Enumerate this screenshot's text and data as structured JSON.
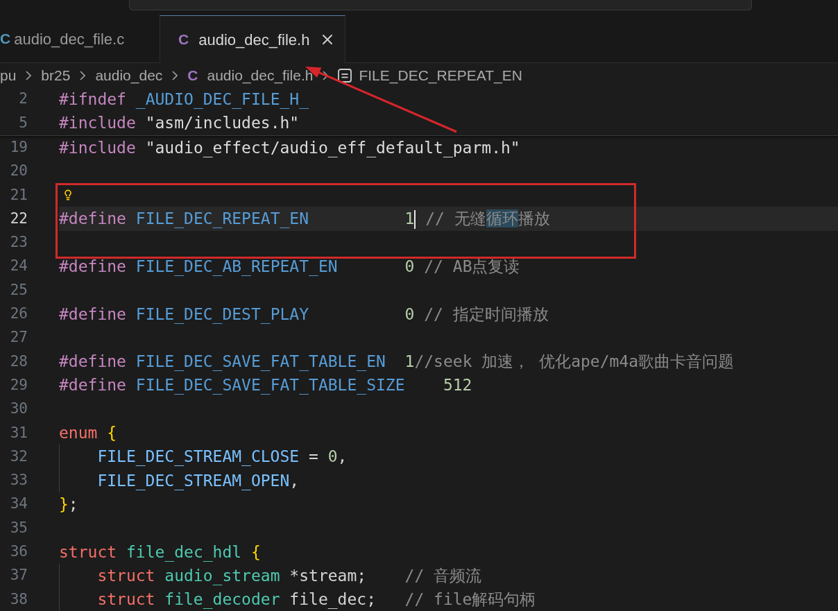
{
  "tabs": [
    {
      "icon": "C",
      "color": "#519aba",
      "label": "audio_dec_file.c",
      "selected": false
    },
    {
      "icon": "C",
      "color": "#a074c4",
      "label": "audio_dec_file.h",
      "selected": true
    }
  ],
  "breadcrumb": [
    {
      "kind": "folder",
      "label": "pu"
    },
    {
      "kind": "folder",
      "label": "br25"
    },
    {
      "kind": "folder",
      "label": "audio_dec"
    },
    {
      "kind": "file",
      "icon": "C",
      "color": "#a074c4",
      "label": "audio_dec_file.h"
    },
    {
      "kind": "symbol",
      "label": "FILE_DEC_REPEAT_EN"
    }
  ],
  "editor": {
    "sticky_lines": [
      {
        "number": "2",
        "current": false,
        "code_action": false,
        "indented": false,
        "tokens": [
          {
            "text": "#ifndef",
            "kind": "preprocessor"
          },
          {
            "text": " _AUDIO_DEC_FILE_H_",
            "kind": "macro"
          }
        ]
      },
      {
        "number": "5",
        "current": false,
        "code_action": false,
        "indented": false,
        "tokens": [
          {
            "text": "#include",
            "kind": "preprocessor"
          },
          {
            "text": " \"asm/includes.h\"",
            "kind": "string"
          }
        ]
      }
    ],
    "lines": [
      {
        "number": "19",
        "current": false,
        "code_action": false,
        "indented": false,
        "tokens": [
          {
            "text": "#include",
            "kind": "preprocessor"
          },
          {
            "text": " \"audio_effect/audio_eff_default_parm.h\"",
            "kind": "string"
          }
        ]
      },
      {
        "number": "20",
        "current": false,
        "code_action": false,
        "indented": false
      },
      {
        "number": "21",
        "current": false,
        "code_action": true,
        "indented": false
      },
      {
        "number": "22",
        "current": true,
        "code_action": false,
        "indented": false,
        "tokens": [
          {
            "text": "#define",
            "kind": "preprocessor"
          },
          {
            "text": " FILE_DEC_REPEAT_EN",
            "kind": "macro"
          },
          {
            "text": "          1",
            "kind": "number"
          },
          {
            "kind": "cursor"
          },
          {
            "kind": "comment",
            "segments": [
              {
                "text": " // 无缝",
                "highlighted": false
              },
              {
                "text": "循环",
                "highlighted": true
              },
              {
                "text": "播放",
                "highlighted": false
              }
            ]
          }
        ]
      },
      {
        "number": "23",
        "current": false,
        "code_action": false,
        "indented": false
      },
      {
        "number": "24",
        "current": false,
        "code_action": false,
        "indented": false,
        "tokens": [
          {
            "text": "#define",
            "kind": "preprocessor"
          },
          {
            "text": " FILE_DEC_AB_REPEAT_EN",
            "kind": "macro"
          },
          {
            "text": "       0",
            "kind": "number"
          },
          {
            "text": " // AB点复读",
            "kind": "comment"
          }
        ]
      },
      {
        "number": "25",
        "current": false,
        "code_action": false,
        "indented": false
      },
      {
        "number": "26",
        "current": false,
        "code_action": false,
        "indented": false,
        "tokens": [
          {
            "text": "#define",
            "kind": "preprocessor"
          },
          {
            "text": " FILE_DEC_DEST_PLAY",
            "kind": "macro"
          },
          {
            "text": "          0",
            "kind": "number"
          },
          {
            "text": " // 指定时间播放",
            "kind": "comment"
          }
        ]
      },
      {
        "number": "27",
        "current": false,
        "code_action": false,
        "indented": false
      },
      {
        "number": "28",
        "current": false,
        "code_action": false,
        "indented": false,
        "tokens": [
          {
            "text": "#define",
            "kind": "preprocessor"
          },
          {
            "text": " FILE_DEC_SAVE_FAT_TABLE_EN",
            "kind": "macro"
          },
          {
            "text": "  1",
            "kind": "number"
          },
          {
            "text": "//seek 加速， 优化ape/m4a歌曲卡音问题",
            "kind": "comment"
          }
        ]
      },
      {
        "number": "29",
        "current": false,
        "code_action": false,
        "indented": false,
        "tokens": [
          {
            "text": "#define",
            "kind": "preprocessor"
          },
          {
            "text": " FILE_DEC_SAVE_FAT_TABLE_SIZE",
            "kind": "macro"
          },
          {
            "text": "    512",
            "kind": "number"
          }
        ]
      },
      {
        "number": "30",
        "current": false,
        "code_action": false,
        "indented": false
      },
      {
        "number": "31",
        "current": false,
        "code_action": false,
        "indented": false,
        "tokens": [
          {
            "text": "enum",
            "kind": "keyword"
          },
          {
            "text": " {",
            "kind": "brace"
          }
        ]
      },
      {
        "number": "32",
        "current": false,
        "code_action": false,
        "indented": true,
        "tokens": [
          {
            "text": "FILE_DEC_STREAM_CLOSE",
            "kind": "constant"
          },
          {
            "text": " =",
            "kind": "plain"
          },
          {
            "text": " 0",
            "kind": "number"
          },
          {
            "text": ",",
            "kind": "plain"
          }
        ]
      },
      {
        "number": "33",
        "current": false,
        "code_action": false,
        "indented": true,
        "tokens": [
          {
            "text": "FILE_DEC_STREAM_OPEN",
            "kind": "constant"
          },
          {
            "text": ",",
            "kind": "plain"
          }
        ]
      },
      {
        "number": "34",
        "current": false,
        "code_action": false,
        "indented": false,
        "tokens": [
          {
            "text": "}",
            "kind": "brace"
          },
          {
            "text": ";",
            "kind": "plain"
          }
        ]
      },
      {
        "number": "35",
        "current": false,
        "code_action": false,
        "indented": false
      },
      {
        "number": "36",
        "current": false,
        "code_action": false,
        "indented": false,
        "tokens": [
          {
            "text": "struct",
            "kind": "keyword"
          },
          {
            "text": " file_dec_hdl",
            "kind": "type"
          },
          {
            "text": " {",
            "kind": "brace"
          }
        ]
      },
      {
        "number": "37",
        "current": false,
        "code_action": false,
        "indented": true,
        "tokens": [
          {
            "text": "struct",
            "kind": "keyword"
          },
          {
            "text": " audio_stream",
            "kind": "type"
          },
          {
            "text": " *stream;",
            "kind": "plain"
          },
          {
            "text": "    // 音频流",
            "kind": "comment"
          }
        ]
      },
      {
        "number": "38",
        "current": false,
        "code_action": false,
        "indented": true,
        "tokens": [
          {
            "text": "struct",
            "kind": "keyword"
          },
          {
            "text": " file_decoder",
            "kind": "type"
          },
          {
            "text": " file_dec;",
            "kind": "plain"
          },
          {
            "text": "   // file解码句柄",
            "kind": "comment"
          }
        ]
      }
    ]
  }
}
